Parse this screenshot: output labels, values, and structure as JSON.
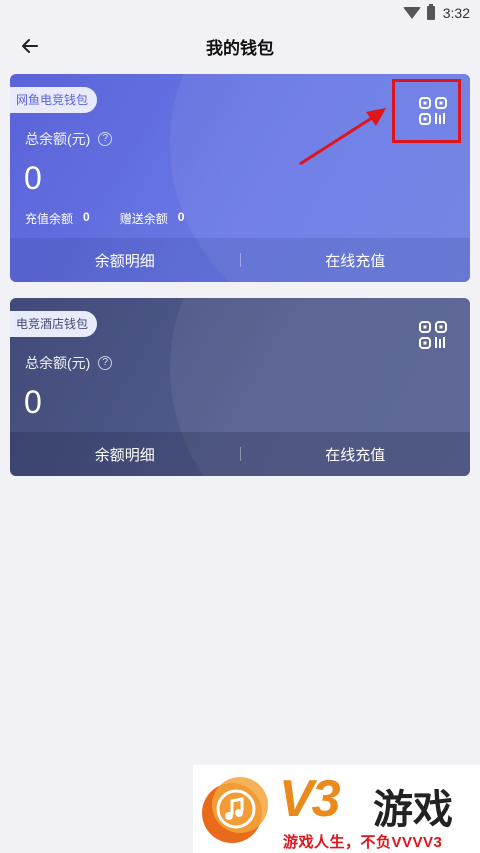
{
  "status_bar": {
    "time": "3:32"
  },
  "header": {
    "title": "我的钱包"
  },
  "cards": [
    {
      "tag": "网鱼电竞钱包",
      "balance_label": "总余额(元)",
      "help": "?",
      "balance": "0",
      "recharge_label": "充值余额",
      "recharge_value": "0",
      "gift_label": "赠送余额",
      "gift_value": "0",
      "detail_button": "余额明细",
      "topup_button": "在线充值"
    },
    {
      "tag": "电竞酒店钱包",
      "balance_label": "总余额(元)",
      "help": "?",
      "balance": "0",
      "detail_button": "余额明细",
      "topup_button": "在线充值"
    }
  ],
  "watermark": {
    "brand": "V3",
    "name": "游戏",
    "slogan": "游戏人生，不负VVVV3"
  },
  "colors": {
    "card1": "#5a63d8",
    "card2": "#414a78",
    "highlight": "#e0141b",
    "brand_orange": "#ea8a1c"
  },
  "icons": [
    "back-arrow-icon",
    "qr-code-icon",
    "help-icon",
    "wifi-icon",
    "battery-icon"
  ]
}
